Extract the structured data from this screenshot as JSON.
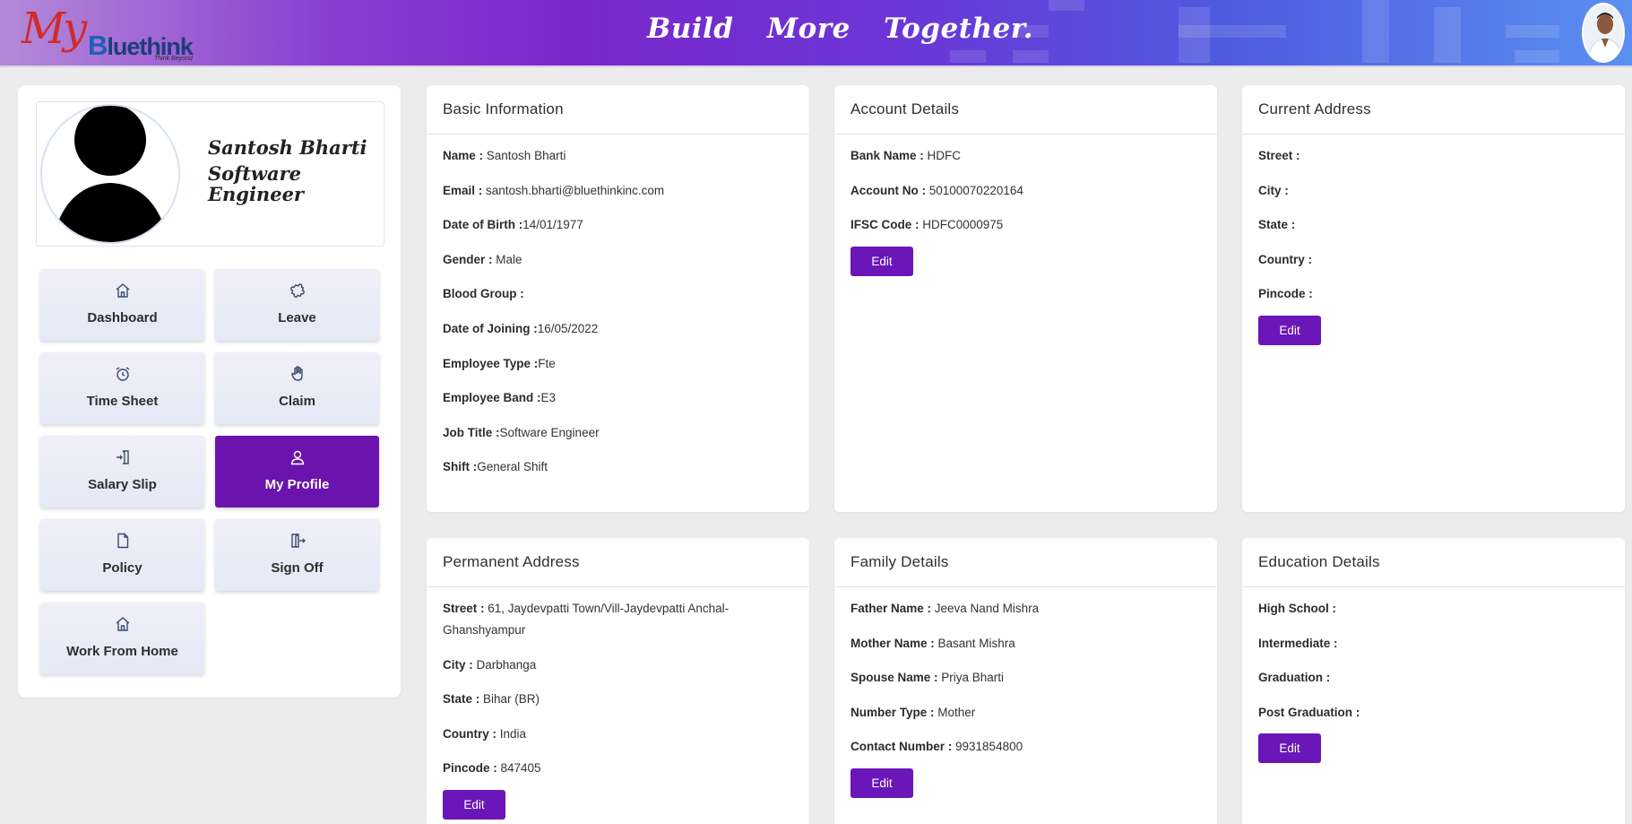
{
  "header": {
    "logo_my": "My",
    "logo_b": "B",
    "logo_rest": "luethink",
    "logo_tagline": "Think Beyond",
    "tagline": "Build More Together."
  },
  "profile": {
    "name": "Santosh Bharti",
    "role": "Software Engineer"
  },
  "nav": [
    {
      "label": "Dashboard",
      "icon": "home-icon"
    },
    {
      "label": "Leave",
      "icon": "puzzle-icon"
    },
    {
      "label": "Time Sheet",
      "icon": "alarm-clock-icon"
    },
    {
      "label": "Claim",
      "icon": "hand-icon"
    },
    {
      "label": "Salary Slip",
      "icon": "door-enter-icon"
    },
    {
      "label": "My Profile",
      "icon": "user-icon",
      "active": true
    },
    {
      "label": "Policy",
      "icon": "file-icon"
    },
    {
      "label": "Sign Off",
      "icon": "sign-out-icon"
    },
    {
      "label": "Work From Home",
      "icon": "home-icon"
    }
  ],
  "basic_info": {
    "title": "Basic Information",
    "rows": [
      {
        "k": "Name : ",
        "v": "Santosh Bharti"
      },
      {
        "k": "Email : ",
        "v": "santosh.bharti@bluethinkinc.com"
      },
      {
        "k": "Date of Birth :",
        "v": "14/01/1977"
      },
      {
        "k": "Gender : ",
        "v": "Male"
      },
      {
        "k": "Blood Group : ",
        "v": ""
      },
      {
        "k": "Date of Joining :",
        "v": "16/05/2022"
      },
      {
        "k": "Employee Type :",
        "v": "Fte"
      },
      {
        "k": "Employee Band :",
        "v": "E3"
      },
      {
        "k": "Job Title :",
        "v": "Software Engineer"
      },
      {
        "k": "Shift :",
        "v": "General Shift"
      }
    ]
  },
  "account": {
    "title": "Account Details",
    "rows": [
      {
        "k": "Bank Name : ",
        "v": "HDFC"
      },
      {
        "k": "Account No : ",
        "v": "50100070220164"
      },
      {
        "k": "IFSC Code : ",
        "v": "HDFC0000975"
      }
    ],
    "edit": "Edit"
  },
  "current_address": {
    "title": "Current Address",
    "rows": [
      {
        "k": "Street : ",
        "v": ""
      },
      {
        "k": "City : ",
        "v": ""
      },
      {
        "k": "State : ",
        "v": ""
      },
      {
        "k": "Country : ",
        "v": ""
      },
      {
        "k": "Pincode : ",
        "v": ""
      }
    ],
    "edit": "Edit"
  },
  "permanent_address": {
    "title": "Permanent Address",
    "rows": [
      {
        "k": "Street : ",
        "v": "61, Jaydevpatti Town/Vill-Jaydevpatti Anchal-Ghanshyampur"
      },
      {
        "k": "City : ",
        "v": "Darbhanga"
      },
      {
        "k": "State : ",
        "v": "Bihar (BR)"
      },
      {
        "k": "Country : ",
        "v": "India"
      },
      {
        "k": "Pincode : ",
        "v": "847405"
      }
    ],
    "edit": "Edit"
  },
  "family": {
    "title": "Family Details",
    "rows": [
      {
        "k": "Father Name : ",
        "v": "Jeeva Nand Mishra"
      },
      {
        "k": "Mother Name : ",
        "v": "Basant Mishra"
      },
      {
        "k": "Spouse Name : ",
        "v": "Priya Bharti"
      },
      {
        "k": "Number Type : ",
        "v": "Mother"
      },
      {
        "k": "Contact Number : ",
        "v": "9931854800"
      }
    ],
    "edit": "Edit"
  },
  "education": {
    "title": "Education Details",
    "rows": [
      {
        "k": "High School : ",
        "v": ""
      },
      {
        "k": "Intermediate : ",
        "v": ""
      },
      {
        "k": "Graduation : ",
        "v": ""
      },
      {
        "k": "Post Graduation : ",
        "v": ""
      }
    ],
    "edit": "Edit"
  },
  "colors": {
    "accent": "#6a16b8",
    "active_tile": "#6a13ad",
    "background": "#ececec"
  }
}
